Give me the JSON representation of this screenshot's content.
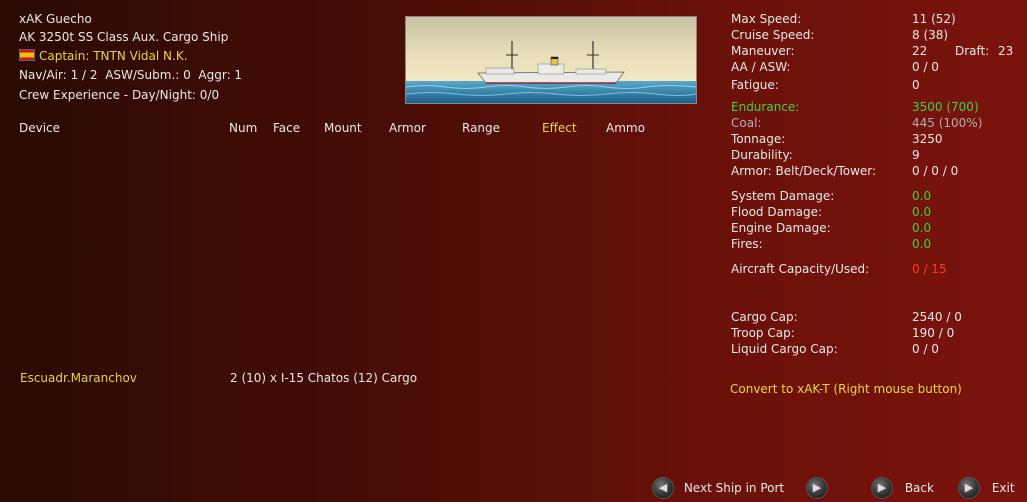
{
  "ship": {
    "name": "xAK Guecho",
    "class": "AK 3250t SS Class Aux. Cargo Ship",
    "captain": "Captain: TNTN Vidal N.K.",
    "nav_air": "Nav/Air: 1 / 2",
    "asw_subm": "ASW/Subm.: 0",
    "aggr": "Aggr: 1",
    "crew_exp": "Crew Experience - Day/Night: 0/0"
  },
  "device_headers": {
    "device": "Device",
    "num": "Num",
    "face": "Face",
    "mount": "Mount",
    "armor": "Armor",
    "range": "Range",
    "effect": "Effect",
    "ammo": "Ammo"
  },
  "air_group": {
    "name": "Escuadr.Maranchov",
    "detail": "2 (10) x I-15 Chatos (12) Cargo"
  },
  "stats": {
    "max_speed_label": "Max Speed:",
    "max_speed": "11 (52)",
    "cruise_speed_label": "Cruise Speed:",
    "cruise_speed": "8 (38)",
    "maneuver_label": "Maneuver:",
    "maneuver": "22",
    "draft_label": "Draft:",
    "draft": "23",
    "aa_asw_label": "AA / ASW:",
    "aa_asw": "0 / 0",
    "fatigue_label": "Fatigue:",
    "fatigue": "0",
    "endurance_label": "Endurance:",
    "endurance": "3500 (700)",
    "coal_label": "Coal:",
    "coal": "445 (100%)",
    "tonnage_label": "Tonnage:",
    "tonnage": "3250",
    "durability_label": "Durability:",
    "durability": "9",
    "armor_label": "Armor: Belt/Deck/Tower:",
    "armor": "0 / 0 / 0",
    "sys_dmg_label": "System Damage:",
    "sys_dmg": "0.0",
    "flood_dmg_label": "Flood Damage:",
    "flood_dmg": "0.0",
    "engine_dmg_label": "Engine Damage:",
    "engine_dmg": "0.0",
    "fires_label": "Fires:",
    "fires": "0.0",
    "aircraft_cap_label": "Aircraft Capacity/Used:",
    "aircraft_cap": "0 / 15",
    "cargo_cap_label": "Cargo Cap:",
    "cargo_cap": "2540 / 0",
    "troop_cap_label": "Troop Cap:",
    "troop_cap": "190 / 0",
    "liquid_cap_label": "Liquid Cargo Cap:",
    "liquid_cap": "0 / 0"
  },
  "convert_action": "Convert to xAK-T (Right mouse button)",
  "nav": {
    "next_ship": "Next Ship in Port",
    "back": "Back",
    "exit": "Exit"
  }
}
